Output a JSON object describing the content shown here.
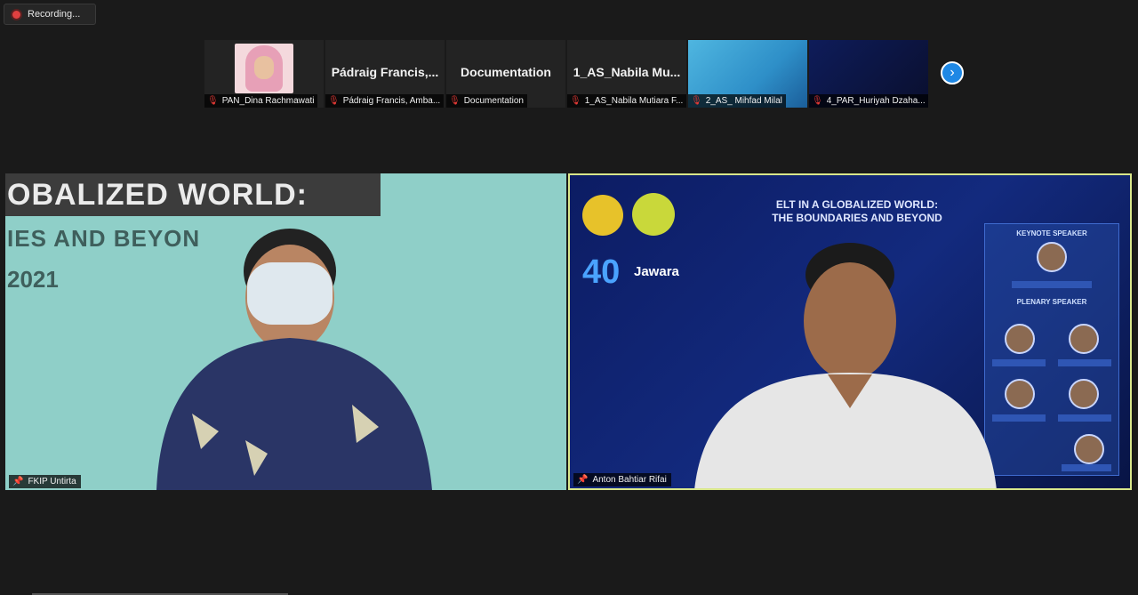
{
  "recording": {
    "label": "Recording..."
  },
  "strip": {
    "participants": [
      {
        "name": "PAN_Dina Rachmawati",
        "display": "",
        "muted": true
      },
      {
        "name": "Pádraig Francis, Amba...",
        "display": "Pádraig  Francis,...",
        "muted": true
      },
      {
        "name": "Documentation",
        "display": "Documentation",
        "muted": true
      },
      {
        "name": "1_AS_Nabila Mutiara F...",
        "display": "1_AS_Nabila  Mu...",
        "muted": true
      },
      {
        "name": "2_AS_ Mihfad Milal",
        "display": "",
        "muted": true
      },
      {
        "name": "4_PAR_Huriyah Dzaha...",
        "display": "",
        "muted": true
      }
    ],
    "next_icon": "chevron-right-icon"
  },
  "main": {
    "left": {
      "name": "FKIP Untirta",
      "banner_line1": "OBALIZED WORLD:",
      "banner_line2": "IES AND BEYON",
      "banner_line3": "2021"
    },
    "right": {
      "name": "Anton Bahtiar Rifai",
      "slide_title_1": "ELT IN A GLOBALIZED WORLD:",
      "slide_title_2": "THE BOUNDARIES AND BEYOND",
      "logo_number": "40",
      "logo_text": "Jawara",
      "keynote_header": "KEYNOTE SPEAKER",
      "plenary_header": "PLENARY SPEAKER",
      "active_speaker_border": "#d8e68a"
    }
  },
  "colors": {
    "background": "#1a1a1a",
    "accent": "#1e88e5",
    "muted": "#e53935"
  }
}
